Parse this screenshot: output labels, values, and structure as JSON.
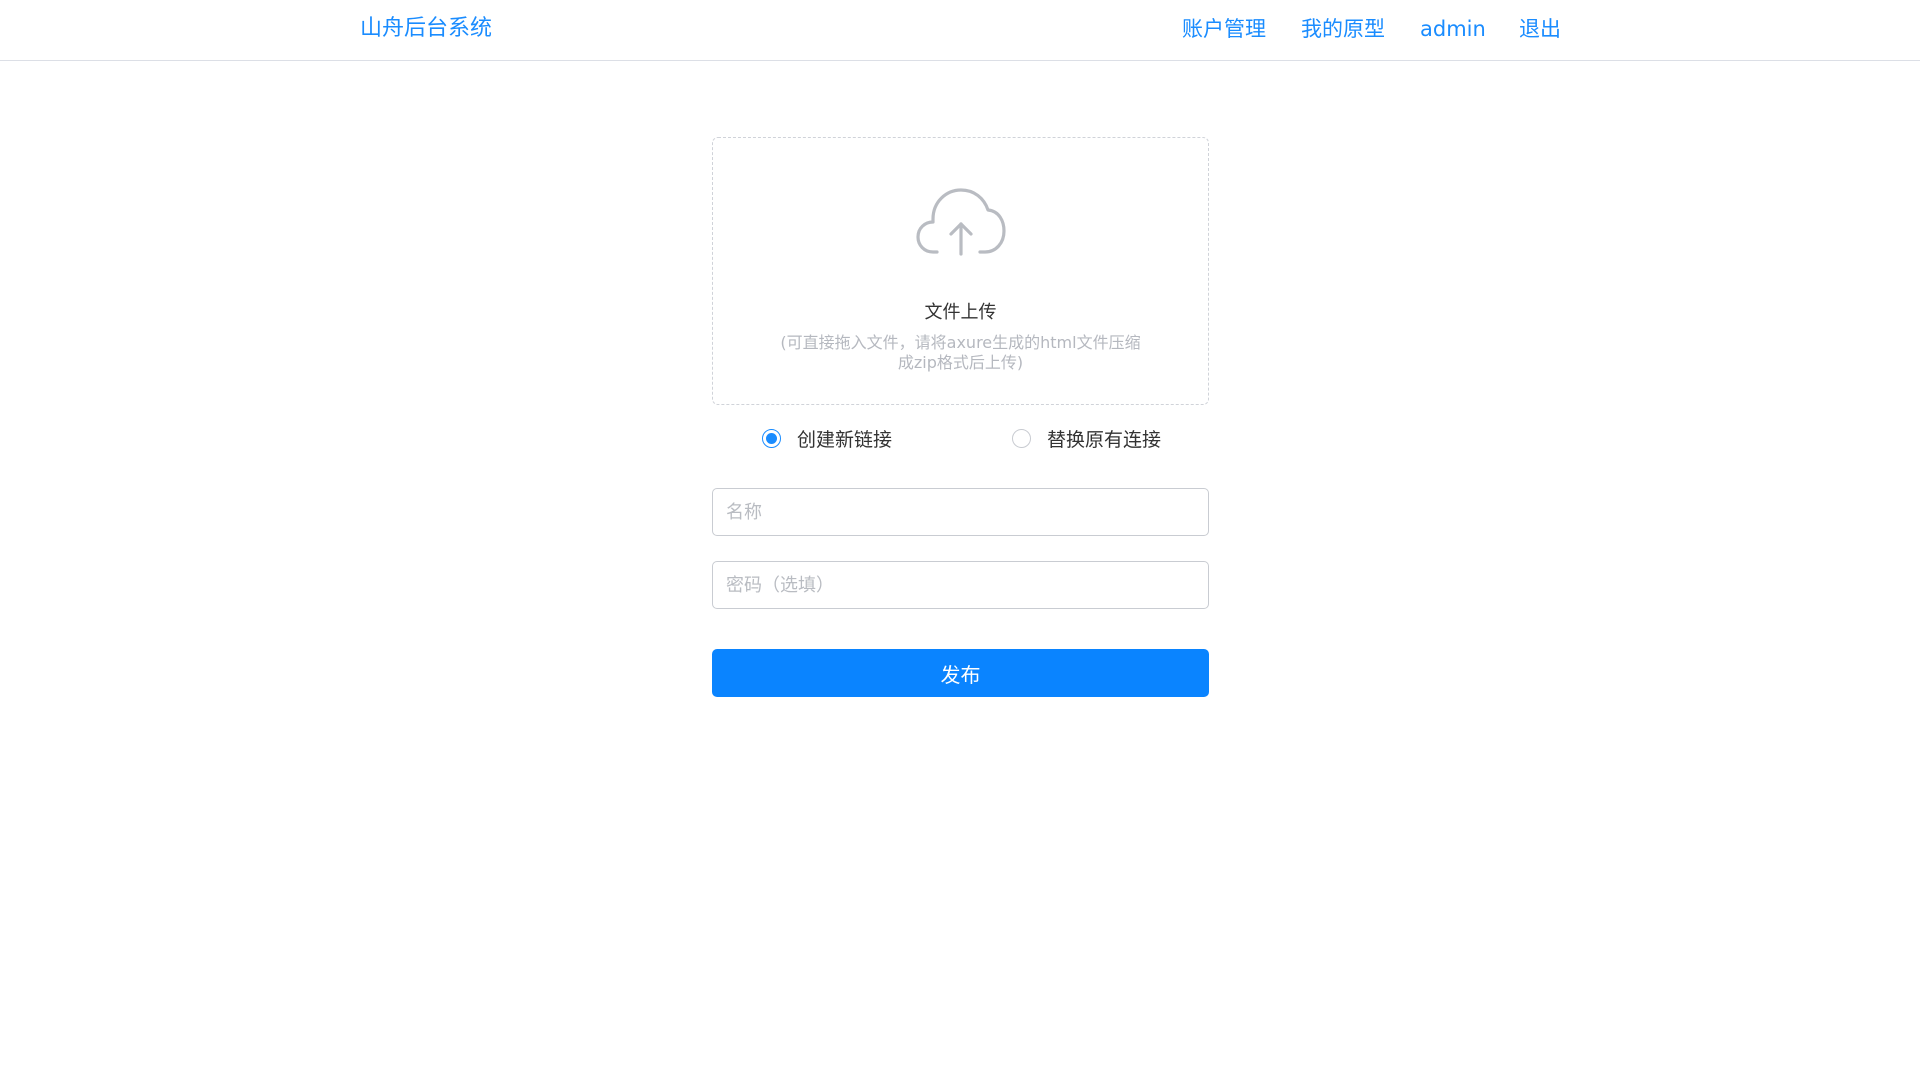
{
  "header": {
    "brand": "山舟后台系统",
    "nav": {
      "account": "账户管理",
      "prototypes": "我的原型",
      "user": "admin",
      "logout": "退出"
    }
  },
  "upload": {
    "icon": "cloud-upload-icon",
    "title": "文件上传",
    "hint": "(可直接拖入文件，请将axure生成的html文件压缩成zip格式后上传)"
  },
  "link_mode": {
    "options": [
      "创建新链接",
      "替换原有连接"
    ],
    "selected": "创建新链接"
  },
  "form": {
    "name": {
      "value": "",
      "placeholder": "名称"
    },
    "password": {
      "value": "",
      "placeholder": "密码（选填）"
    },
    "submit_label": "发布"
  },
  "colors": {
    "accent": "#1a8cff",
    "button": "#0a84ff",
    "border": "#dcdfe6",
    "hint": "#b5b8bf"
  }
}
